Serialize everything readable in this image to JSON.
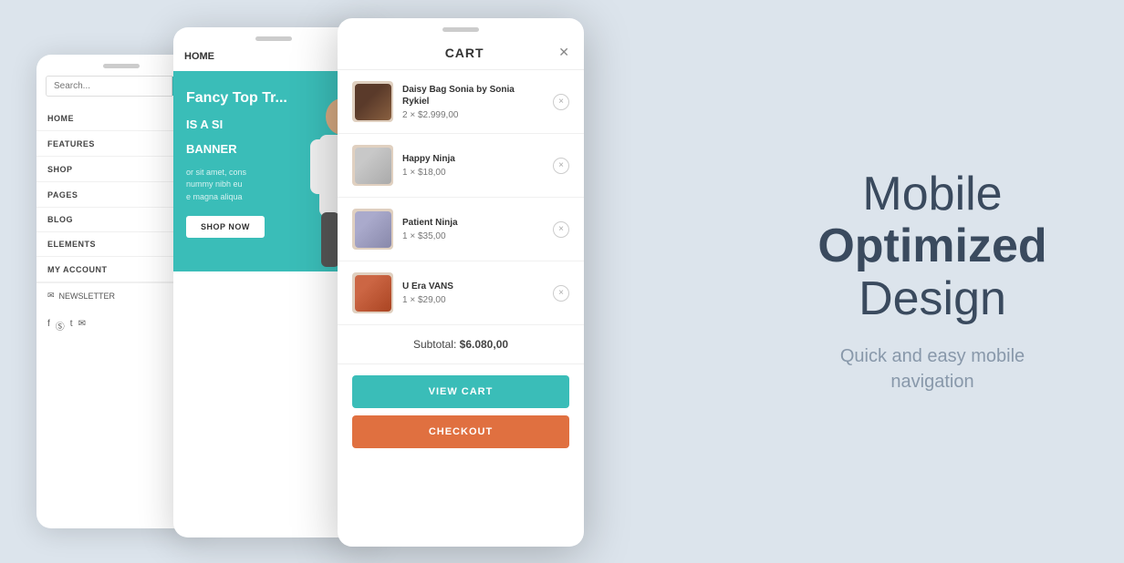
{
  "page": {
    "background": "#dce4ec"
  },
  "phone_sidebar": {
    "search_placeholder": "Search...",
    "nav_items": [
      {
        "label": "HOME",
        "has_chevron": true
      },
      {
        "label": "FEATURES",
        "has_chevron": true
      },
      {
        "label": "SHOP",
        "has_chevron": true
      },
      {
        "label": "PAGES",
        "has_chevron": true
      },
      {
        "label": "BLOG",
        "has_chevron": false
      },
      {
        "label": "ELEMENTS",
        "has_chevron": false
      },
      {
        "label": "MY ACCOUNT",
        "has_chevron": true
      }
    ],
    "newsletter_label": "NEWSLETTER"
  },
  "phone_banner": {
    "title": "HOME",
    "banner_heading": "Fancy Top Tr...",
    "banner_sub1": "IS A SI",
    "banner_sub2": "BANNER",
    "banner_body": "or sit amet, cons\nnummy nibh eu\ne magna aliqua",
    "shop_now": "SHOP NOW"
  },
  "phone_cart": {
    "title": "CART",
    "close_label": "✕",
    "items": [
      {
        "name": "Daisy Bag Sonia by Sonia Rykiel",
        "qty": "2",
        "price": "$2.999,00",
        "img_type": "bag"
      },
      {
        "name": "Happy Ninja",
        "qty": "1",
        "price": "$18,00",
        "img_type": "tshirt"
      },
      {
        "name": "Patient Ninja",
        "qty": "1",
        "price": "$35,00",
        "img_type": "hoodie"
      },
      {
        "name": "U Era VANS",
        "qty": "1",
        "price": "$29,00",
        "img_type": "pants"
      }
    ],
    "subtotal_label": "Subtotal:",
    "subtotal_value": "$6.080,00",
    "view_cart_label": "VIEW CART",
    "checkout_label": "CHECKOUT"
  },
  "promo": {
    "line1": "Mobile",
    "line2": "Optimized",
    "line3": "Design",
    "subtitle_line1": "Quick and easy mobile",
    "subtitle_line2": "navigation"
  }
}
